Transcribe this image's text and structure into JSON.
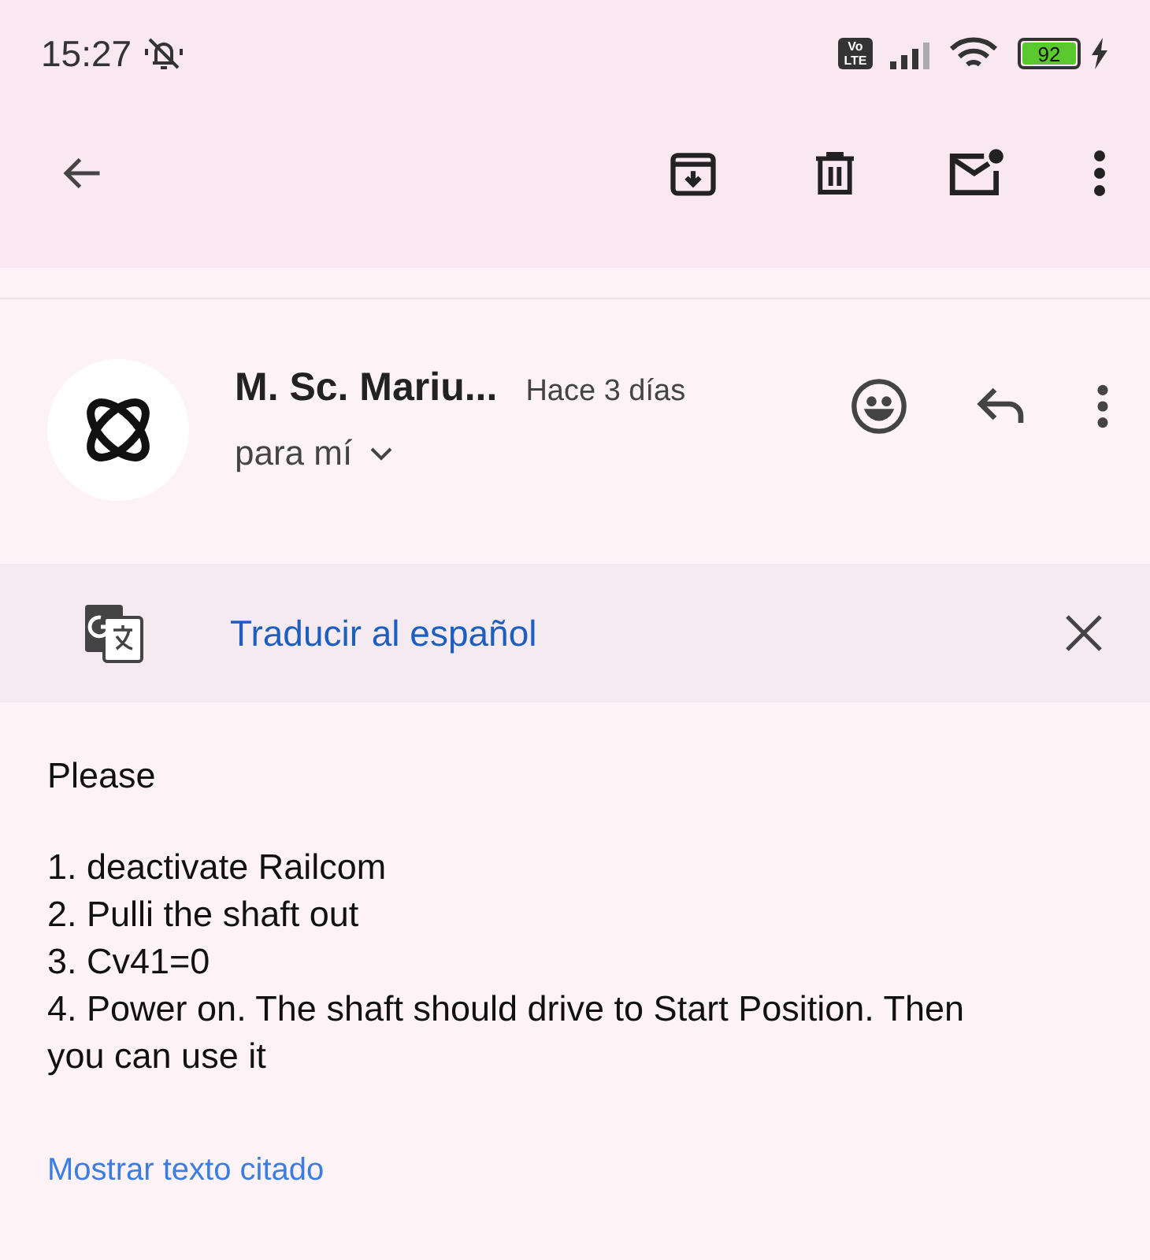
{
  "status_bar": {
    "time": "15:27",
    "volte_top": "Vo",
    "volte_bottom": "LTE",
    "battery": "92"
  },
  "toolbar": {
    "actions": [
      {
        "kind": "archive"
      },
      {
        "kind": "delete"
      },
      {
        "kind": "mark-unread"
      },
      {
        "kind": "more"
      }
    ]
  },
  "message": {
    "sender": "M. Sc. Mariu...",
    "time": "Hace 3 días",
    "recipient": "para mí"
  },
  "translate_bar": {
    "link": "Traducir al español"
  },
  "body": {
    "greeting": "Please",
    "lines": [
      "1. deactivate Railcom",
      "2. Pulli the shaft out",
      "3. Cv41=0",
      "4. Power on. The shaft should drive to Start Position. Then you can use it"
    ],
    "quoted_link": "Mostrar texto citado"
  }
}
